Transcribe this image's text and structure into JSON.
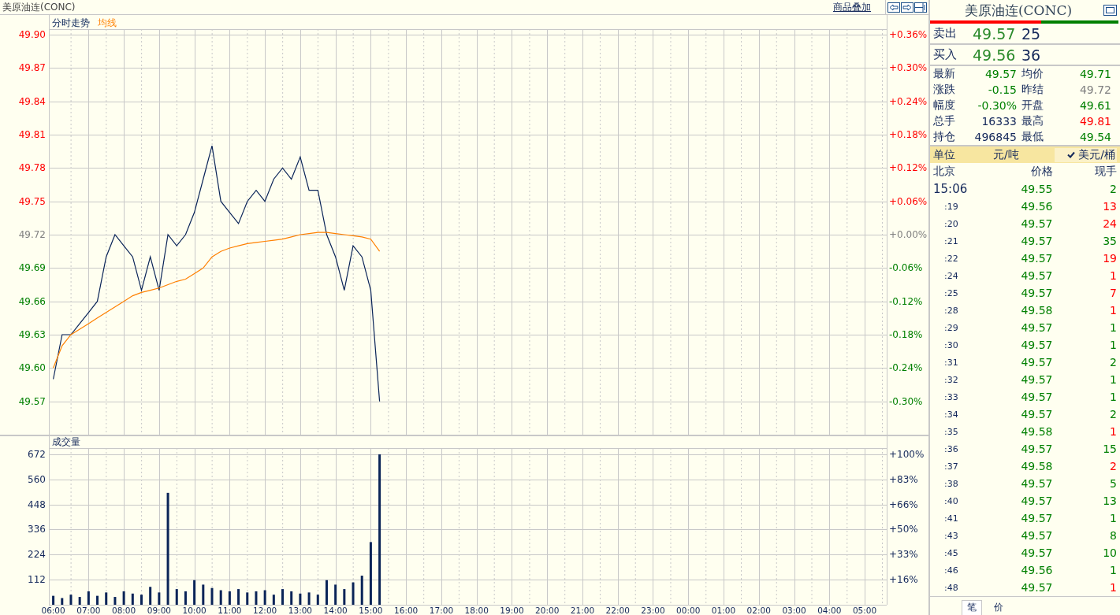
{
  "title_bar": {
    "title": "美原油连(CONC)",
    "overlay_link": "商品叠加"
  },
  "price_chart": {
    "right_ticks": [
      {
        "label": "+0.36%",
        "color": "#ff0000"
      },
      {
        "label": "+0.30%",
        "color": "#ff0000"
      },
      {
        "label": "+0.24%",
        "color": "#ff0000"
      },
      {
        "label": "+0.18%",
        "color": "#ff0000"
      },
      {
        "label": "+0.12%",
        "color": "#ff0000"
      },
      {
        "label": "+0.06%",
        "color": "#ff0000"
      },
      {
        "label": "+0.00%",
        "color": "#808080"
      },
      {
        "label": "-0.06%",
        "color": "#008000"
      },
      {
        "label": "-0.12%",
        "color": "#008000"
      },
      {
        "label": "-0.18%",
        "color": "#008000"
      },
      {
        "label": "-0.24%",
        "color": "#008000"
      },
      {
        "label": "-0.30%",
        "color": "#008000"
      }
    ],
    "chart_data": {
      "type": "line",
      "grid": true,
      "ylim": [
        49.54,
        49.905
      ],
      "categories": [
        null,
        null,
        null,
        null,
        null,
        null,
        null,
        null,
        null,
        null,
        null,
        null,
        null,
        null,
        null,
        null,
        null,
        null,
        null,
        null,
        null,
        null,
        null,
        null,
        null,
        null,
        null,
        null,
        null,
        null,
        null,
        null,
        null,
        null,
        null,
        null,
        null,
        null,
        null,
        null,
        null,
        null,
        null,
        null,
        null,
        null,
        null,
        null,
        null,
        null,
        null,
        null,
        null,
        null,
        null,
        null,
        null,
        null,
        null,
        null,
        null,
        null,
        null,
        null,
        null,
        null,
        null,
        null,
        null,
        null,
        null,
        null,
        null,
        null,
        null,
        null,
        null,
        null,
        null,
        null,
        null,
        null,
        null,
        null,
        null,
        null,
        null,
        null,
        null,
        null,
        null,
        null,
        null,
        null,
        null
      ],
      "series": [
        {
          "name": "分时走势",
          "color": "#0a2458",
          "values": [
            49.59,
            49.63,
            49.63,
            49.64,
            49.65,
            49.66,
            49.7,
            49.72,
            49.71,
            49.7,
            49.67,
            49.7,
            49.67,
            49.72,
            49.71,
            49.72,
            49.74,
            49.77,
            49.8,
            49.75,
            49.74,
            49.73,
            49.75,
            49.76,
            49.75,
            49.77,
            49.78,
            49.77,
            49.79,
            49.76,
            49.76,
            49.72,
            49.7,
            49.67,
            49.71,
            49.7,
            49.67,
            49.57,
            null,
            null,
            null,
            null,
            null,
            null,
            null,
            null,
            null,
            null,
            null,
            null,
            null,
            null,
            null,
            null,
            null,
            null,
            null,
            null,
            null,
            null,
            null,
            null,
            null,
            null,
            null,
            null,
            null,
            null,
            null,
            null,
            null,
            null,
            null,
            null,
            null,
            null,
            null,
            null,
            null,
            null,
            null,
            null,
            null,
            null,
            null,
            null,
            null,
            null,
            null,
            null,
            null,
            null,
            null,
            null,
            null
          ]
        },
        {
          "name": "均线",
          "color": "#ff8000",
          "values": [
            49.6,
            49.62,
            49.63,
            49.635,
            49.64,
            49.645,
            49.65,
            49.655,
            49.66,
            49.665,
            49.668,
            49.67,
            49.672,
            49.675,
            49.678,
            49.68,
            49.685,
            49.69,
            49.7,
            49.705,
            49.708,
            49.71,
            49.712,
            49.713,
            49.714,
            49.715,
            49.716,
            49.718,
            49.72,
            49.721,
            49.722,
            49.722,
            49.721,
            49.72,
            49.719,
            49.718,
            49.716,
            49.705,
            null,
            null,
            null,
            null,
            null,
            null,
            null,
            null,
            null,
            null,
            null,
            null,
            null,
            null,
            null,
            null,
            null,
            null,
            null,
            null,
            null,
            null,
            null,
            null,
            null,
            null,
            null,
            null,
            null,
            null,
            null,
            null,
            null,
            null,
            null,
            null,
            null,
            null,
            null,
            null,
            null,
            null,
            null,
            null,
            null,
            null,
            null,
            null,
            null,
            null,
            null,
            null,
            null,
            null,
            null,
            null,
            null
          ]
        }
      ],
      "yticks": [
        {
          "value": 49.9,
          "label": "49.90"
        },
        {
          "value": 49.87,
          "label": "49.87"
        },
        {
          "value": 49.84,
          "label": "49.84"
        },
        {
          "value": 49.81,
          "label": "49.81"
        },
        {
          "value": 49.78,
          "label": "49.78"
        },
        {
          "value": 49.75,
          "label": "49.75"
        },
        {
          "value": 49.72,
          "label": "49.72"
        },
        {
          "value": 49.69,
          "label": "49.69"
        },
        {
          "value": 49.66,
          "label": "49.66"
        },
        {
          "value": 49.63,
          "label": "49.63"
        },
        {
          "value": 49.6,
          "label": "49.60"
        },
        {
          "value": 49.57,
          "label": "49.57"
        }
      ]
    }
  },
  "volume_chart": {
    "title": "成交量",
    "right_ticks": [
      "+100%",
      "+83%",
      "+66%",
      "+50%",
      "+33%",
      "+16%"
    ],
    "chart_data": {
      "type": "bar",
      "grid": true,
      "ylim": [
        0,
        700
      ],
      "categories": [
        "06:00",
        null,
        null,
        null,
        "07:00",
        null,
        null,
        null,
        "08:00",
        null,
        null,
        null,
        "09:00",
        null,
        null,
        null,
        "10:00",
        null,
        null,
        null,
        "11:00",
        null,
        null,
        null,
        "12:00",
        null,
        null,
        null,
        "13:00",
        null,
        null,
        null,
        "14:00",
        null,
        null,
        null,
        "15:00",
        null,
        null,
        null,
        "16:00",
        null,
        null,
        null,
        "17:00",
        null,
        null,
        null,
        "18:00",
        null,
        null,
        null,
        "19:00",
        null,
        null,
        null,
        "20:00",
        null,
        null,
        null,
        "21:00",
        null,
        null,
        null,
        "22:00",
        null,
        null,
        null,
        "23:00",
        null,
        null,
        null,
        "00:00",
        null,
        null,
        null,
        "01:00",
        null,
        null,
        null,
        "02:00",
        null,
        null,
        null,
        "03:00",
        null,
        null,
        null,
        "04:00",
        null,
        null,
        null,
        "05:00",
        null,
        null
      ],
      "values": [
        40,
        30,
        45,
        35,
        60,
        40,
        55,
        35,
        60,
        50,
        45,
        80,
        55,
        500,
        70,
        60,
        110,
        90,
        75,
        65,
        60,
        70,
        55,
        60,
        65,
        45,
        70,
        60,
        50,
        55,
        45,
        110,
        90,
        70,
        100,
        130,
        280,
        672,
        null,
        null,
        null,
        null,
        null,
        null,
        null,
        null,
        null,
        null,
        null,
        null,
        null,
        null,
        null,
        null,
        null,
        null,
        null,
        null,
        null,
        null,
        null,
        null,
        null,
        null,
        null,
        null,
        null,
        null,
        null,
        null,
        null,
        null,
        null,
        null,
        null,
        null,
        null,
        null,
        null,
        null,
        null,
        null,
        null,
        null,
        null,
        null,
        null,
        null,
        null,
        null,
        null,
        null,
        null,
        null,
        null
      ],
      "yticks": [
        672,
        560,
        448,
        336,
        224,
        112
      ]
    }
  },
  "quote": {
    "title": "美原油连(CONC)",
    "ratio_bar": {
      "level": 0.59
    },
    "bid_ask": [
      {
        "label": "卖出",
        "price": "49.57",
        "volume": "25"
      },
      {
        "label": "买入",
        "price": "49.56",
        "volume": "36"
      }
    ],
    "stats": [
      {
        "label": "最新",
        "value": "49.57",
        "color": "#008000"
      },
      {
        "label": "均价",
        "value": "49.71",
        "color": "#008000"
      },
      {
        "label": "涨跌",
        "value": "-0.15",
        "color": "#008000"
      },
      {
        "label": "昨结",
        "value": "49.72",
        "color": "#808080"
      },
      {
        "label": "幅度",
        "value": "-0.30%",
        "color": "#008000"
      },
      {
        "label": "开盘",
        "value": "49.61",
        "color": "#008000"
      },
      {
        "label": "总手",
        "value": "16333",
        "color": "#14285a"
      },
      {
        "label": "最高",
        "value": "49.81",
        "color": "#ff0000"
      },
      {
        "label": "持仓",
        "value": "496845",
        "color": "#14285a"
      },
      {
        "label": "最低",
        "value": "49.54",
        "color": "#008000"
      }
    ],
    "units": {
      "label": "单位",
      "options": [
        {
          "label": "元/吨",
          "selected": false
        },
        {
          "label": "美元/桶",
          "selected": true
        }
      ]
    },
    "trades": {
      "columns": [
        "北京",
        "价格",
        "现手"
      ],
      "rows": [
        {
          "time": "15:06",
          "kind": "full",
          "price": "49.55",
          "volume": "2",
          "color": "#008000"
        },
        {
          "time": ":19",
          "kind": "minute",
          "price": "49.56",
          "volume": "13",
          "color": "#ff0000"
        },
        {
          "time": ":20",
          "kind": "minute",
          "price": "49.57",
          "volume": "24",
          "color": "#ff0000"
        },
        {
          "time": ":21",
          "kind": "minute",
          "price": "49.57",
          "volume": "35",
          "color": "#008000"
        },
        {
          "time": ":22",
          "kind": "minute",
          "price": "49.57",
          "volume": "19",
          "color": "#ff0000"
        },
        {
          "time": ":24",
          "kind": "minute",
          "price": "49.57",
          "volume": "1",
          "color": "#ff0000"
        },
        {
          "time": ":25",
          "kind": "minute",
          "price": "49.57",
          "volume": "7",
          "color": "#ff0000"
        },
        {
          "time": ":28",
          "kind": "minute",
          "price": "49.58",
          "volume": "1",
          "color": "#ff0000"
        },
        {
          "time": ":29",
          "kind": "minute",
          "price": "49.57",
          "volume": "1",
          "color": "#008000"
        },
        {
          "time": ":30",
          "kind": "minute",
          "price": "49.57",
          "volume": "1",
          "color": "#008000"
        },
        {
          "time": ":31",
          "kind": "minute",
          "price": "49.57",
          "volume": "2",
          "color": "#008000"
        },
        {
          "time": ":32",
          "kind": "minute",
          "price": "49.57",
          "volume": "1",
          "color": "#008000"
        },
        {
          "time": ":33",
          "kind": "minute",
          "price": "49.57",
          "volume": "1",
          "color": "#008000"
        },
        {
          "time": ":34",
          "kind": "minute",
          "price": "49.57",
          "volume": "2",
          "color": "#008000"
        },
        {
          "time": ":35",
          "kind": "minute",
          "price": "49.58",
          "volume": "1",
          "color": "#ff0000"
        },
        {
          "time": ":36",
          "kind": "minute",
          "price": "49.57",
          "volume": "15",
          "color": "#008000"
        },
        {
          "time": ":37",
          "kind": "minute",
          "price": "49.58",
          "volume": "2",
          "color": "#ff0000"
        },
        {
          "time": ":38",
          "kind": "minute",
          "price": "49.57",
          "volume": "5",
          "color": "#008000"
        },
        {
          "time": ":40",
          "kind": "minute",
          "price": "49.57",
          "volume": "13",
          "color": "#008000"
        },
        {
          "time": ":41",
          "kind": "minute",
          "price": "49.57",
          "volume": "1",
          "color": "#008000"
        },
        {
          "time": ":43",
          "kind": "minute",
          "price": "49.57",
          "volume": "8",
          "color": "#008000"
        },
        {
          "time": ":45",
          "kind": "minute",
          "price": "49.57",
          "volume": "10",
          "color": "#008000"
        },
        {
          "time": ":46",
          "kind": "minute",
          "price": "49.56",
          "volume": "1",
          "color": "#008000"
        },
        {
          "time": ":48",
          "kind": "minute",
          "price": "49.57",
          "volume": "1",
          "color": "#ff0000"
        }
      ]
    },
    "bottom_tabs": [
      {
        "label": "笔",
        "selected": true
      },
      {
        "label": "价",
        "selected": false
      }
    ]
  }
}
